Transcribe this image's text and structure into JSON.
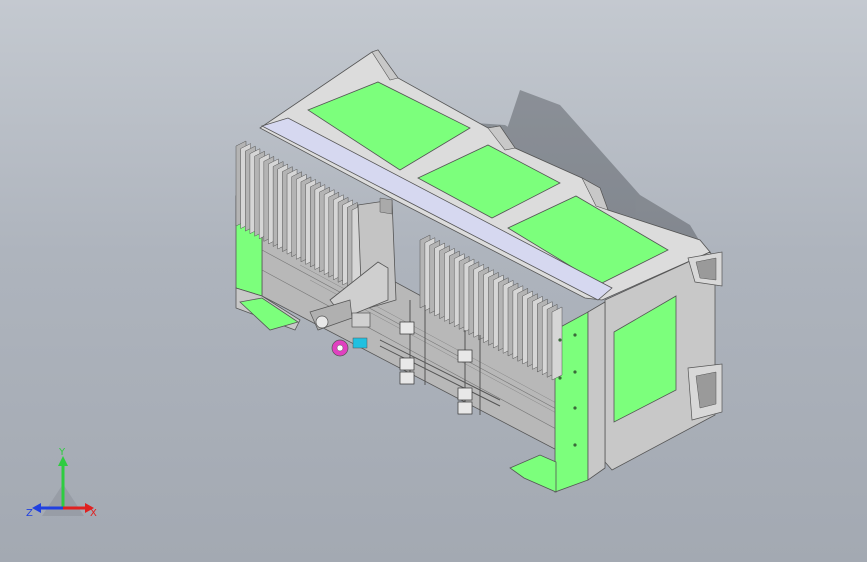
{
  "viewport": {
    "background_top": "#c4c9d0",
    "background_bottom": "#a3a9b2",
    "model": {
      "colors": {
        "face_green": "#7cff7c",
        "face_green_dark": "#5fe85f",
        "frame_light": "#dcdcdc",
        "frame_mid": "#c8c8c8",
        "frame_dark": "#9a9a9a",
        "rail_blue": "#d6d8f0",
        "accent_magenta": "#e040c0",
        "accent_cyan": "#20c0e0"
      }
    }
  },
  "triad": {
    "y_label": "Y",
    "x_label": "X",
    "z_label": "Z",
    "y_color": "#2ecc40",
    "x_color": "#e02020",
    "z_color": "#2040e0"
  }
}
